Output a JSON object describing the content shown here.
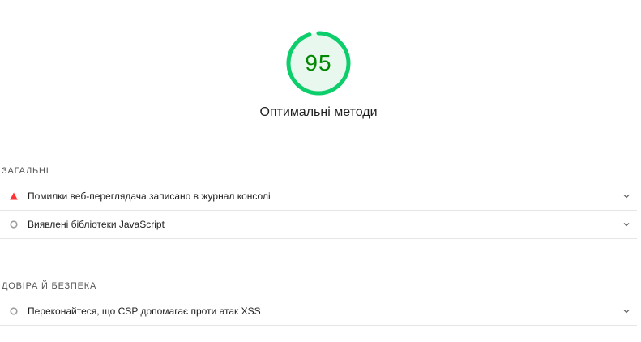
{
  "score": {
    "value": "95",
    "fraction": 0.95,
    "color": "#0cce6b",
    "text_color": "#008800",
    "fill_color": "#e8f8ee"
  },
  "category": {
    "title": "Оптимальні методи"
  },
  "groups": [
    {
      "header": "ЗАГАЛЬНІ",
      "audits": [
        {
          "label": "Помилки веб-переглядача записано в журнал консолі",
          "icon": "fail-triangle-icon",
          "status_color": "#ff3333"
        },
        {
          "label": "Виявлені бібліотеки JavaScript",
          "icon": "informative-circle-icon",
          "status_color": "#9e9e9e"
        }
      ]
    },
    {
      "header": "ДОВІРА Й БЕЗПЕКА",
      "audits": [
        {
          "label": "Переконайтеся, що CSP допомагає проти атак XSS",
          "icon": "informative-circle-icon",
          "status_color": "#9e9e9e"
        }
      ]
    }
  ]
}
